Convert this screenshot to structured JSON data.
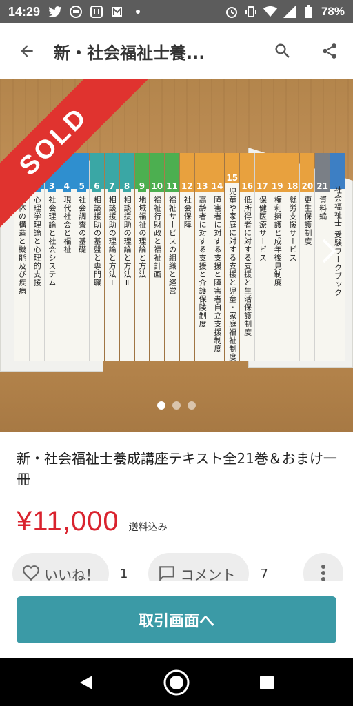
{
  "status_bar": {
    "time": "14:29",
    "battery": "78%"
  },
  "app_bar": {
    "title": "新・社会福祉士養..."
  },
  "photo": {
    "sold_label": "SOLD",
    "page_count": 3,
    "active_page": 0,
    "books": [
      {
        "num": "1",
        "title": "人体の構造と機能及び疾病",
        "color": "#2f8fcf"
      },
      {
        "num": "2",
        "title": "心理学理論と心理的支援",
        "color": "#2f8fcf"
      },
      {
        "num": "3",
        "title": "社会理論と社会システム",
        "color": "#2f8fcf"
      },
      {
        "num": "4",
        "title": "現代社会と福祉",
        "color": "#2f8fcf"
      },
      {
        "num": "5",
        "title": "社会調査の基礎",
        "color": "#2f8fcf"
      },
      {
        "num": "6",
        "title": "相談援助の基盤と専門職",
        "color": "#3aa7a5"
      },
      {
        "num": "7",
        "title": "相談援助の理論と方法Ⅰ",
        "color": "#3aa7a5"
      },
      {
        "num": "8",
        "title": "相談援助の理論と方法Ⅱ",
        "color": "#3aa7a5"
      },
      {
        "num": "9",
        "title": "地域福祉の理論と方法",
        "color": "#4caf50"
      },
      {
        "num": "10",
        "title": "福祉行財政と福祉計画",
        "color": "#4caf50"
      },
      {
        "num": "11",
        "title": "福祉サービスの組織と経営",
        "color": "#4caf50"
      },
      {
        "num": "12",
        "title": "社会保障",
        "color": "#e8a13e"
      },
      {
        "num": "13",
        "title": "高齢者に対する支援と介護保険制度",
        "color": "#e8a13e"
      },
      {
        "num": "14",
        "title": "障害者に対する支援と障害者自立支援制度",
        "color": "#e8a13e"
      },
      {
        "num": "15",
        "title": "児童や家庭に対する支援と児童・家庭福祉制度",
        "color": "#e8a13e"
      },
      {
        "num": "16",
        "title": "低所得者に対する支援と生活保護制度",
        "color": "#e8a13e"
      },
      {
        "num": "17",
        "title": "保健医療サービス",
        "color": "#e8a13e"
      },
      {
        "num": "19",
        "title": "権利擁護と成年後見制度",
        "color": "#e8a13e"
      },
      {
        "num": "18",
        "title": "就労支援サービス",
        "color": "#e8a13e"
      },
      {
        "num": "20",
        "title": "更生保護制度",
        "color": "#e8a13e"
      },
      {
        "num": "21",
        "title": "資料編",
        "color": "#7a7f86"
      },
      {
        "num": "",
        "title": "社会福祉士 受験ワークブック",
        "color": "#3d7fc4"
      }
    ]
  },
  "item": {
    "title": "新・社会福祉士養成講座テキスト全21巻＆おまけ一冊",
    "price": "¥11,000",
    "shipping": "送料込み"
  },
  "actions": {
    "like_label": "いいね！",
    "like_count": "1",
    "comment_label": "コメント",
    "comment_count": "7"
  },
  "cta": {
    "label": "取引画面へ"
  }
}
